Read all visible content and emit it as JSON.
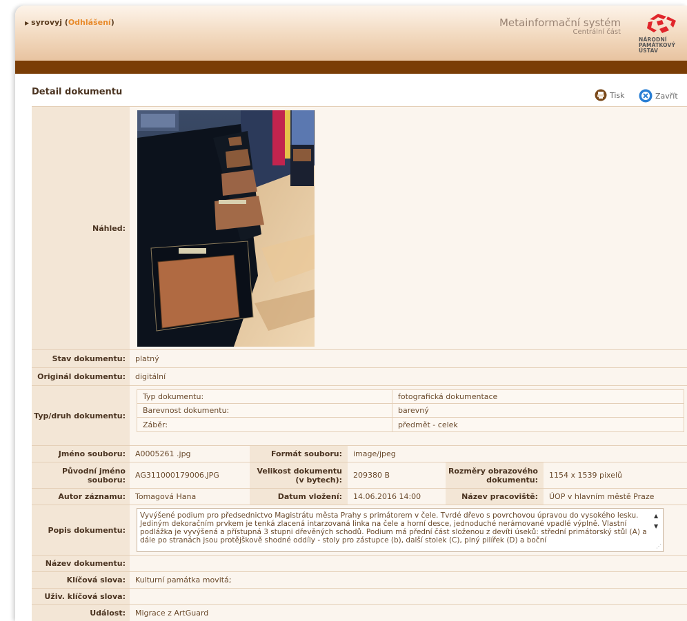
{
  "header": {
    "user": "syrovyj",
    "logout": "Odhlášení",
    "system_title": "Metainformační systém",
    "system_subtitle": "Centrální část",
    "logo_lines": [
      "NÁRODNÍ",
      "PAMÁTKOVÝ",
      "ÚSTAV"
    ]
  },
  "page": {
    "title": "Detail dokumentu",
    "print_label": "Tisk",
    "close_label": "Zavřít"
  },
  "labels": {
    "preview": "Náhled:",
    "status": "Stav dokumentu:",
    "original": "Originál dokumentu:",
    "type": "Typ/druh dokumentu:",
    "filename": "Jméno souboru:",
    "format": "Formát souboru:",
    "orig_filename": "Původní jméno souboru:",
    "size": "Velikost dokumentu (v bytech):",
    "dimensions": "Rozměry obrazového dokumentu:",
    "author": "Autor záznamu:",
    "date": "Datum vložení:",
    "workplace": "Název pracoviště:",
    "description": "Popis dokumentu:",
    "doc_name": "Název dokumentu:",
    "keywords": "Klíčová slova:",
    "user_keywords": "Uživ. klíčová slova:",
    "event": "Událost:"
  },
  "values": {
    "status": "platný",
    "original": "digitální",
    "filename": "A0005261 .jpg",
    "format": "image/jpeg",
    "orig_filename": "AG311000179006.JPG",
    "size": "209380 B",
    "dimensions": "1154 x 1539 pixelů",
    "author": "Tomagová Hana",
    "date": "14.06.2016 14:00",
    "workplace": "ÚOP v hlavním městě Praze",
    "description": "Vyvýšené podium pro předsednictvo Magistrátu města Prahy s primátorem v čele. Tvrdé dřevo s povrchovou úpravou do vysokého lesku. Jediným dekoračním prvkem je tenká zlacená intarzovaná linka na čele a horní desce, jednoduché nerámované vpadlé výplně. Vlastní podlážka je vyvýšená a přístupná 3 stupni dřevěných schodů. Podium má přední část složenou z devíti úseků: střední primátorský stůl (A) a dále po stranách jsou protějškově shodné oddíly - stoly pro zástupce (b), další stolek (C), plný pilířek (D) a boční",
    "doc_name": "",
    "keywords": "Kulturní památka movitá;",
    "user_keywords": "",
    "event": "Migrace z ArtGuard"
  },
  "type_rows": [
    {
      "key": "Typ dokumentu:",
      "value": "fotografická dokumentace"
    },
    {
      "key": "Barevnost dokumentu:",
      "value": "barevný"
    },
    {
      "key": "Záběr:",
      "value": "předmět - celek"
    }
  ],
  "colors": {
    "brown_bar": "#7a3d06",
    "label_bg": "#f3e6d6",
    "value_bg": "#fbf5ee",
    "logout_link": "#e88a2a",
    "logo_red": "#e0262b"
  },
  "icons": {
    "print": "print-icon",
    "close": "close-icon",
    "logo": "npu-logo-icon"
  }
}
